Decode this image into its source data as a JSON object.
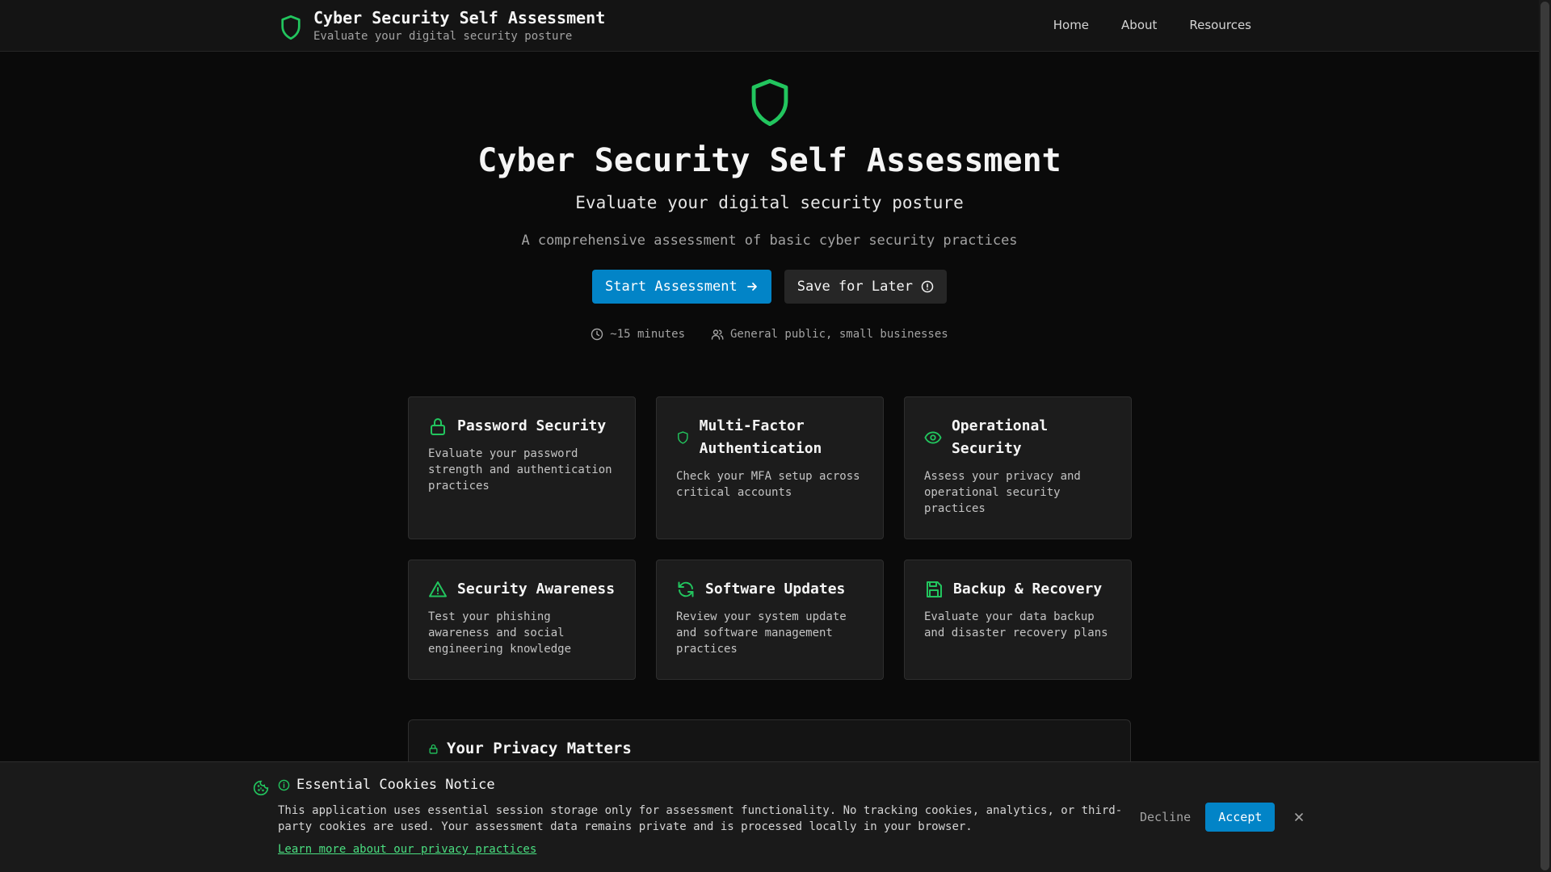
{
  "header": {
    "title": "Cyber Security Self Assessment",
    "subtitle": "Evaluate your digital security posture",
    "nav": [
      {
        "label": "Home"
      },
      {
        "label": "About"
      },
      {
        "label": "Resources"
      }
    ]
  },
  "hero": {
    "title": "Cyber Security Self Assessment",
    "subtitle": "Evaluate your digital security posture",
    "description": "A comprehensive assessment of basic cyber security practices",
    "start_label": "Start Assessment",
    "save_label": "Save for Later",
    "meta_time": "~15 minutes",
    "meta_audience": "General public, small businesses"
  },
  "cards": [
    {
      "icon": "lock-icon",
      "title": "Password Security",
      "desc": "Evaluate your password strength and authentication practices"
    },
    {
      "icon": "shield-icon",
      "title": "Multi-Factor Authentication",
      "desc": "Check your MFA setup across critical accounts"
    },
    {
      "icon": "eye-icon",
      "title": "Operational Security",
      "desc": "Assess your privacy and operational security practices"
    },
    {
      "icon": "warning-icon",
      "title": "Security Awareness",
      "desc": "Test your phishing awareness and social engineering knowledge"
    },
    {
      "icon": "refresh-icon",
      "title": "Software Updates",
      "desc": "Review your system update and software management practices"
    },
    {
      "icon": "save-icon",
      "title": "Backup & Recovery",
      "desc": "Evaluate your data backup and disaster recovery plans"
    }
  ],
  "privacy": {
    "title": "Your Privacy Matters"
  },
  "cookie": {
    "title": "Essential Cookies Notice",
    "text": "This application uses essential session storage only for assessment functionality. No tracking cookies, analytics, or third-party cookies are used. Your assessment data remains private and is processed locally in your browser.",
    "link": "Learn more about our privacy practices",
    "decline_label": "Decline",
    "accept_label": "Accept"
  },
  "colors": {
    "accent_green": "#22c55e",
    "primary_blue": "#0284c7",
    "background": "#0a0a0a"
  }
}
